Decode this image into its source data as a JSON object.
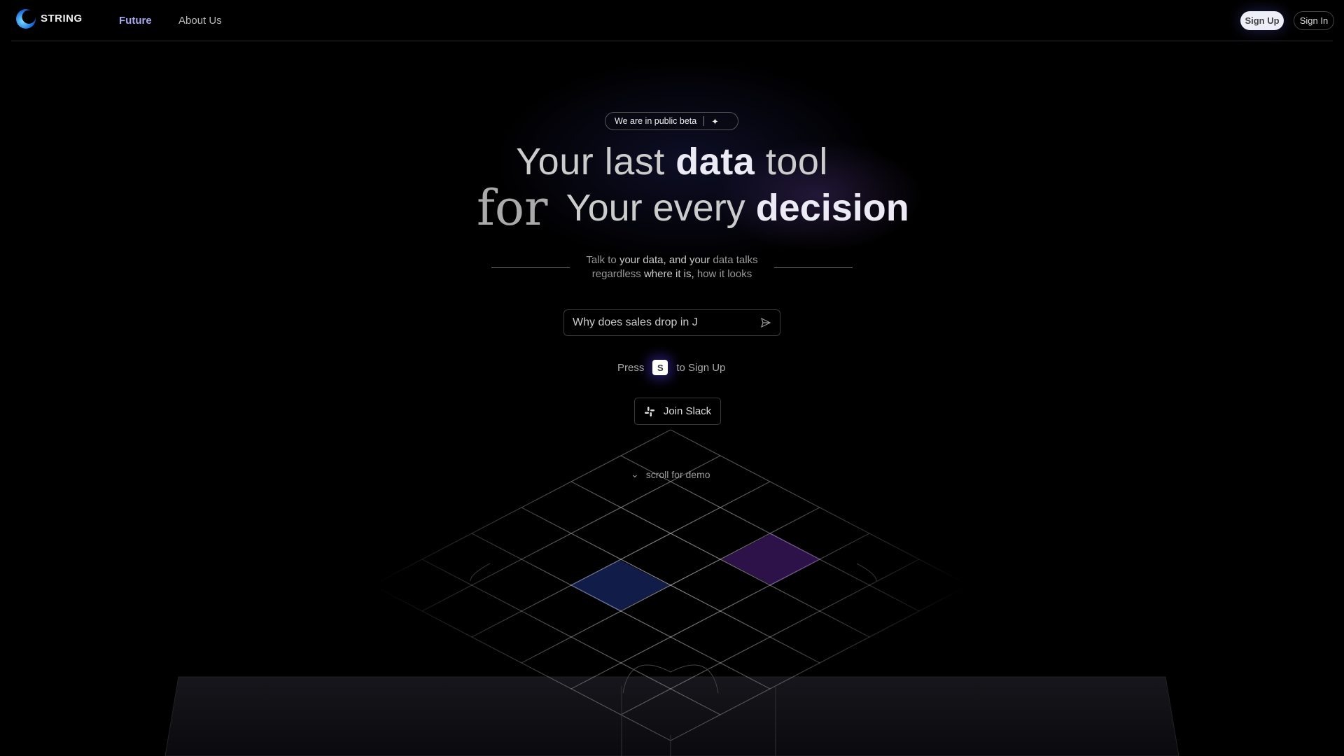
{
  "header": {
    "brand": "STRING",
    "nav": [
      {
        "label": "Future",
        "active": true
      },
      {
        "label": "About Us"
      }
    ],
    "sign_up": "Sign Up",
    "sign_in": "Sign In"
  },
  "hero": {
    "badge": "We are in public beta",
    "badge_icon": "sparkle-icon",
    "line1": {
      "a": "Your last ",
      "b": "data",
      "c": " tool"
    },
    "line2": {
      "for": "for",
      "a": "Your every ",
      "b": "decision"
    },
    "subtitle": {
      "l1a": "Talk to ",
      "l1b": "your data, and your",
      "l1c": " data talks",
      "l2a": "regardless ",
      "l2b": "where it is,",
      "l2c": " how it looks"
    },
    "input_value": "Why does sales drop in J",
    "press": "Press",
    "key": "S",
    "press_after": "to Sign Up",
    "slack": "Join Slack",
    "scroll": "scroll for demo"
  },
  "colors": {
    "accent": "#a8a8f0",
    "background": "#000000"
  }
}
